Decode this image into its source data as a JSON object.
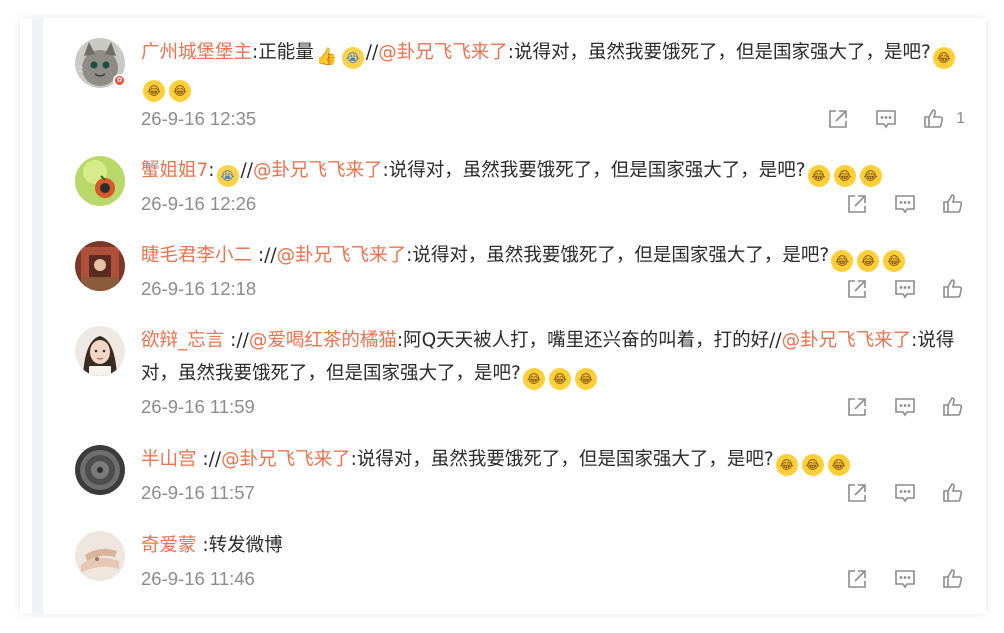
{
  "comments": [
    {
      "user": "广州城堡堡主",
      "has_badge": true,
      "segments": [
        {
          "t": "text",
          "v": ":正能量"
        },
        {
          "t": "emoji",
          "v": "👍",
          "k": "thumb"
        },
        {
          "t": "emoji",
          "v": "😭",
          "k": "cry"
        },
        {
          "t": "text",
          "v": "//"
        },
        {
          "t": "mention",
          "v": "@卦兄飞飞来了"
        },
        {
          "t": "text",
          "v": ":说得对，虽然我要饿死了，但是国家强大了，是吧?"
        },
        {
          "t": "emoji",
          "v": "😂",
          "k": "laugh"
        },
        {
          "t": "emoji",
          "v": "😂",
          "k": "laugh"
        },
        {
          "t": "emoji",
          "v": "😂",
          "k": "laugh"
        }
      ],
      "time": "26-9-16 12:35",
      "likes": "1"
    },
    {
      "user": "蟹姐姐7",
      "has_badge": false,
      "segments": [
        {
          "t": "text",
          "v": ":"
        },
        {
          "t": "emoji",
          "v": "😭",
          "k": "cry"
        },
        {
          "t": "text",
          "v": "//"
        },
        {
          "t": "mention",
          "v": "@卦兄飞飞来了"
        },
        {
          "t": "text",
          "v": ":说得对，虽然我要饿死了，但是国家强大了，是吧?"
        },
        {
          "t": "emoji",
          "v": "😂",
          "k": "laugh"
        },
        {
          "t": "emoji",
          "v": "😂",
          "k": "laugh"
        },
        {
          "t": "emoji",
          "v": "😂",
          "k": "laugh"
        }
      ],
      "time": "26-9-16 12:26",
      "likes": ""
    },
    {
      "user": "睫毛君李小二",
      "has_badge": false,
      "segments": [
        {
          "t": "text",
          "v": " ://"
        },
        {
          "t": "mention",
          "v": "@卦兄飞飞来了"
        },
        {
          "t": "text",
          "v": ":说得对，虽然我要饿死了，但是国家强大了，是吧?"
        },
        {
          "t": "emoji",
          "v": "😂",
          "k": "laugh"
        },
        {
          "t": "emoji",
          "v": "😂",
          "k": "laugh"
        },
        {
          "t": "emoji",
          "v": "😂",
          "k": "laugh"
        }
      ],
      "time": "26-9-16 12:18",
      "likes": ""
    },
    {
      "user": "欲辩_忘言",
      "has_badge": false,
      "segments": [
        {
          "t": "text",
          "v": " ://"
        },
        {
          "t": "mention",
          "v": "@爱喝红茶的橘猫"
        },
        {
          "t": "text",
          "v": ":阿Q天天被人打，嘴里还兴奋的叫着，打的好//"
        },
        {
          "t": "mention",
          "v": "@卦兄飞飞来了"
        },
        {
          "t": "text",
          "v": ":说得对，虽然我要饿死了，但是国家强大了，是吧?"
        },
        {
          "t": "emoji",
          "v": "😂",
          "k": "laugh"
        },
        {
          "t": "emoji",
          "v": "😂",
          "k": "laugh"
        },
        {
          "t": "emoji",
          "v": "😂",
          "k": "laugh"
        }
      ],
      "time": "26-9-16 11:59",
      "likes": ""
    },
    {
      "user": "半山宫",
      "has_badge": false,
      "segments": [
        {
          "t": "text",
          "v": " ://"
        },
        {
          "t": "mention",
          "v": "@卦兄飞飞来了"
        },
        {
          "t": "text",
          "v": ":说得对，虽然我要饿死了，但是国家强大了，是吧?"
        },
        {
          "t": "emoji",
          "v": "😂",
          "k": "laugh"
        },
        {
          "t": "emoji",
          "v": "😂",
          "k": "laugh"
        },
        {
          "t": "emoji",
          "v": "😂",
          "k": "laugh"
        }
      ],
      "time": "26-9-16 11:57",
      "likes": ""
    },
    {
      "user": "奇爱蒙",
      "has_badge": false,
      "segments": [
        {
          "t": "text",
          "v": " :转发微博"
        }
      ],
      "time": "26-9-16 11:46",
      "likes": ""
    }
  ],
  "icons": {
    "repost": "share-icon",
    "comment": "comment-icon",
    "like": "thumb-up-icon"
  },
  "colors": {
    "link": "#eb7350",
    "text": "#2b2b2b",
    "muted": "#8c8c8c",
    "sidebar": "#eff2f6"
  }
}
